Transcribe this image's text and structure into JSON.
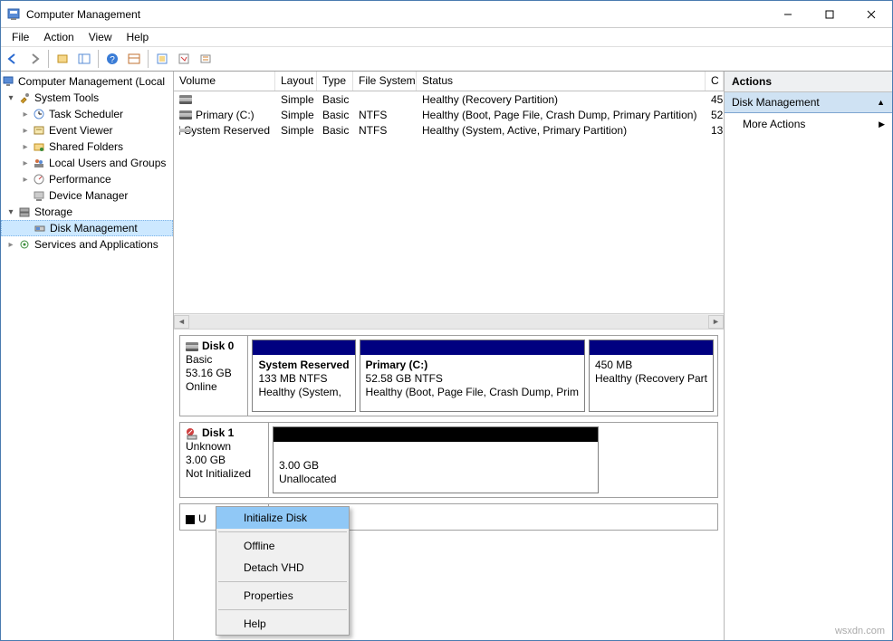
{
  "window": {
    "title": "Computer Management"
  },
  "menu": [
    "File",
    "Action",
    "View",
    "Help"
  ],
  "toolbar_icons": [
    "back",
    "forward",
    "up",
    "show-hide",
    "help",
    "refresh",
    "properties",
    "export",
    "settings"
  ],
  "tree": {
    "root": "Computer Management (Local",
    "n_system_tools": "System Tools",
    "n_task_scheduler": "Task Scheduler",
    "n_event_viewer": "Event Viewer",
    "n_shared_folders": "Shared Folders",
    "n_local_users": "Local Users and Groups",
    "n_performance": "Performance",
    "n_device_manager": "Device Manager",
    "n_storage": "Storage",
    "n_disk_mgmt": "Disk Management",
    "n_services": "Services and Applications"
  },
  "vol_headers": {
    "volume": "Volume",
    "layout": "Layout",
    "type": "Type",
    "fs": "File System",
    "status": "Status",
    "cap": "C"
  },
  "vol_rows": [
    {
      "vol": "",
      "layout": "Simple",
      "type": "Basic",
      "fs": "",
      "status": "Healthy (Recovery Partition)",
      "cap": "45"
    },
    {
      "vol": "Primary (C:)",
      "layout": "Simple",
      "type": "Basic",
      "fs": "NTFS",
      "status": "Healthy (Boot, Page File, Crash Dump, Primary Partition)",
      "cap": "52"
    },
    {
      "vol": "System Reserved",
      "layout": "Simple",
      "type": "Basic",
      "fs": "NTFS",
      "status": "Healthy (System, Active, Primary Partition)",
      "cap": "13"
    }
  ],
  "disk0": {
    "name": "Disk 0",
    "type": "Basic",
    "size": "53.16 GB",
    "state": "Online",
    "parts": [
      {
        "name": "System Reserved",
        "size": "133 MB NTFS",
        "status": "Healthy (System,"
      },
      {
        "name": "Primary  (C:)",
        "size": "52.58 GB NTFS",
        "status": "Healthy (Boot, Page File, Crash Dump, Prim"
      },
      {
        "name": "",
        "size": "450 MB",
        "status": "Healthy (Recovery Part"
      }
    ]
  },
  "disk1": {
    "name": "Disk 1",
    "type": "Unknown",
    "size": "3.00 GB",
    "state": "Not Initialized",
    "part": {
      "size": "3.00 GB",
      "status": "Unallocated"
    }
  },
  "legend": {
    "label": "U"
  },
  "ctx": {
    "initialize": "Initialize Disk",
    "offline": "Offline",
    "detach": "Detach VHD",
    "properties": "Properties",
    "help": "Help"
  },
  "actions": {
    "header": "Actions",
    "section": "Disk Management",
    "more": "More Actions"
  },
  "watermark": "wsxdn.com",
  "colors": {
    "primary_top": "#000080",
    "unalloc_top": "#000000"
  }
}
